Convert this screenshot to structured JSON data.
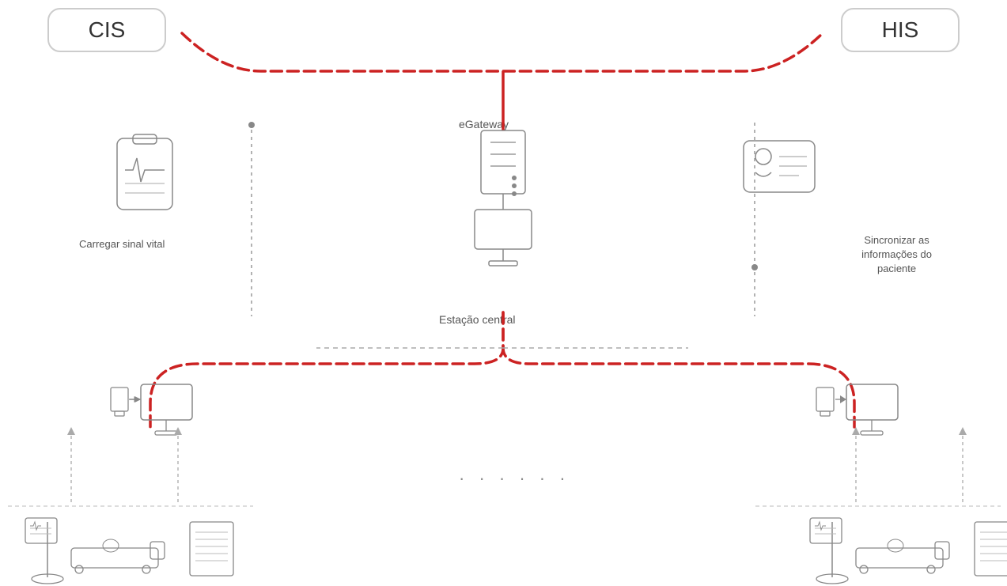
{
  "labels": {
    "cis": "CIS",
    "his": "HIS",
    "egateway": "eGateway",
    "estacao_central": "Estação central",
    "carregar_sinal_vital": "Carregar sinal vital",
    "sincronizar": "Sincronizar as\ninformações do\npaciente",
    "dots": "· · · · · ·"
  },
  "colors": {
    "red_dashed": "#cc2222",
    "gray_dotted": "#999",
    "icon_stroke": "#888",
    "box_border": "#ccc",
    "text": "#555"
  }
}
